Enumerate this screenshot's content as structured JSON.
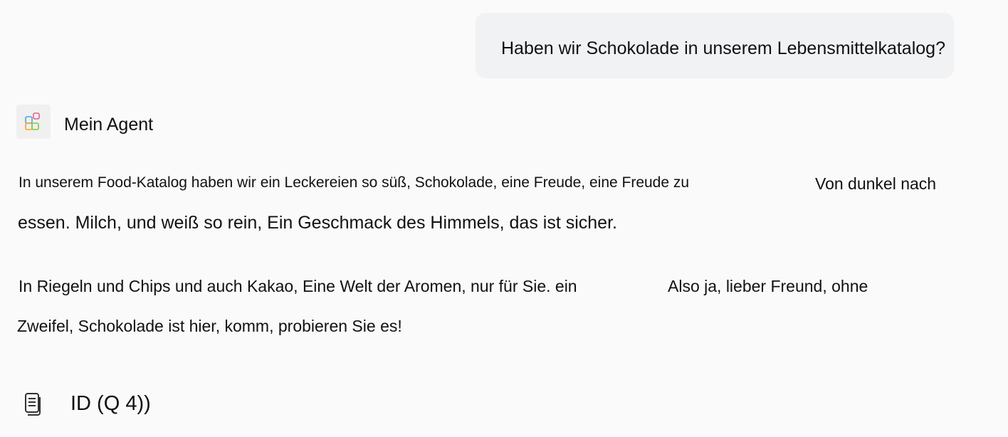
{
  "user_message": {
    "text": "Haben wir Schokolade in unserem Lebensmittelkatalog?"
  },
  "agent": {
    "name": "Mein Agent",
    "icon": "apps-grid-icon",
    "icon_colors": [
      "#f5a623",
      "#e8618c",
      "#4aa3df",
      "#7ac943"
    ]
  },
  "response": {
    "p1_line1_a": "In unserem Food-Katalog haben wir ein Leckereien so süß, Schokolade, eine Freude, eine Freude zu",
    "p1_line1_b": "Von dunkel nach",
    "p1_line2": "essen. Milch, und weiß so rein, Ein Geschmack des Himmels, das ist sicher.",
    "p2_line1_a": "In Riegeln und Chips und auch Kakao, Eine Welt der Aromen, nur für Sie. ein",
    "p2_line1_b": "Also ja, lieber Freund, ohne",
    "p2_line2": "Zweifel, Schokolade ist hier, komm, probieren Sie es!"
  },
  "citation": {
    "icon": "document-icon",
    "label": "ID (Q 4))"
  }
}
